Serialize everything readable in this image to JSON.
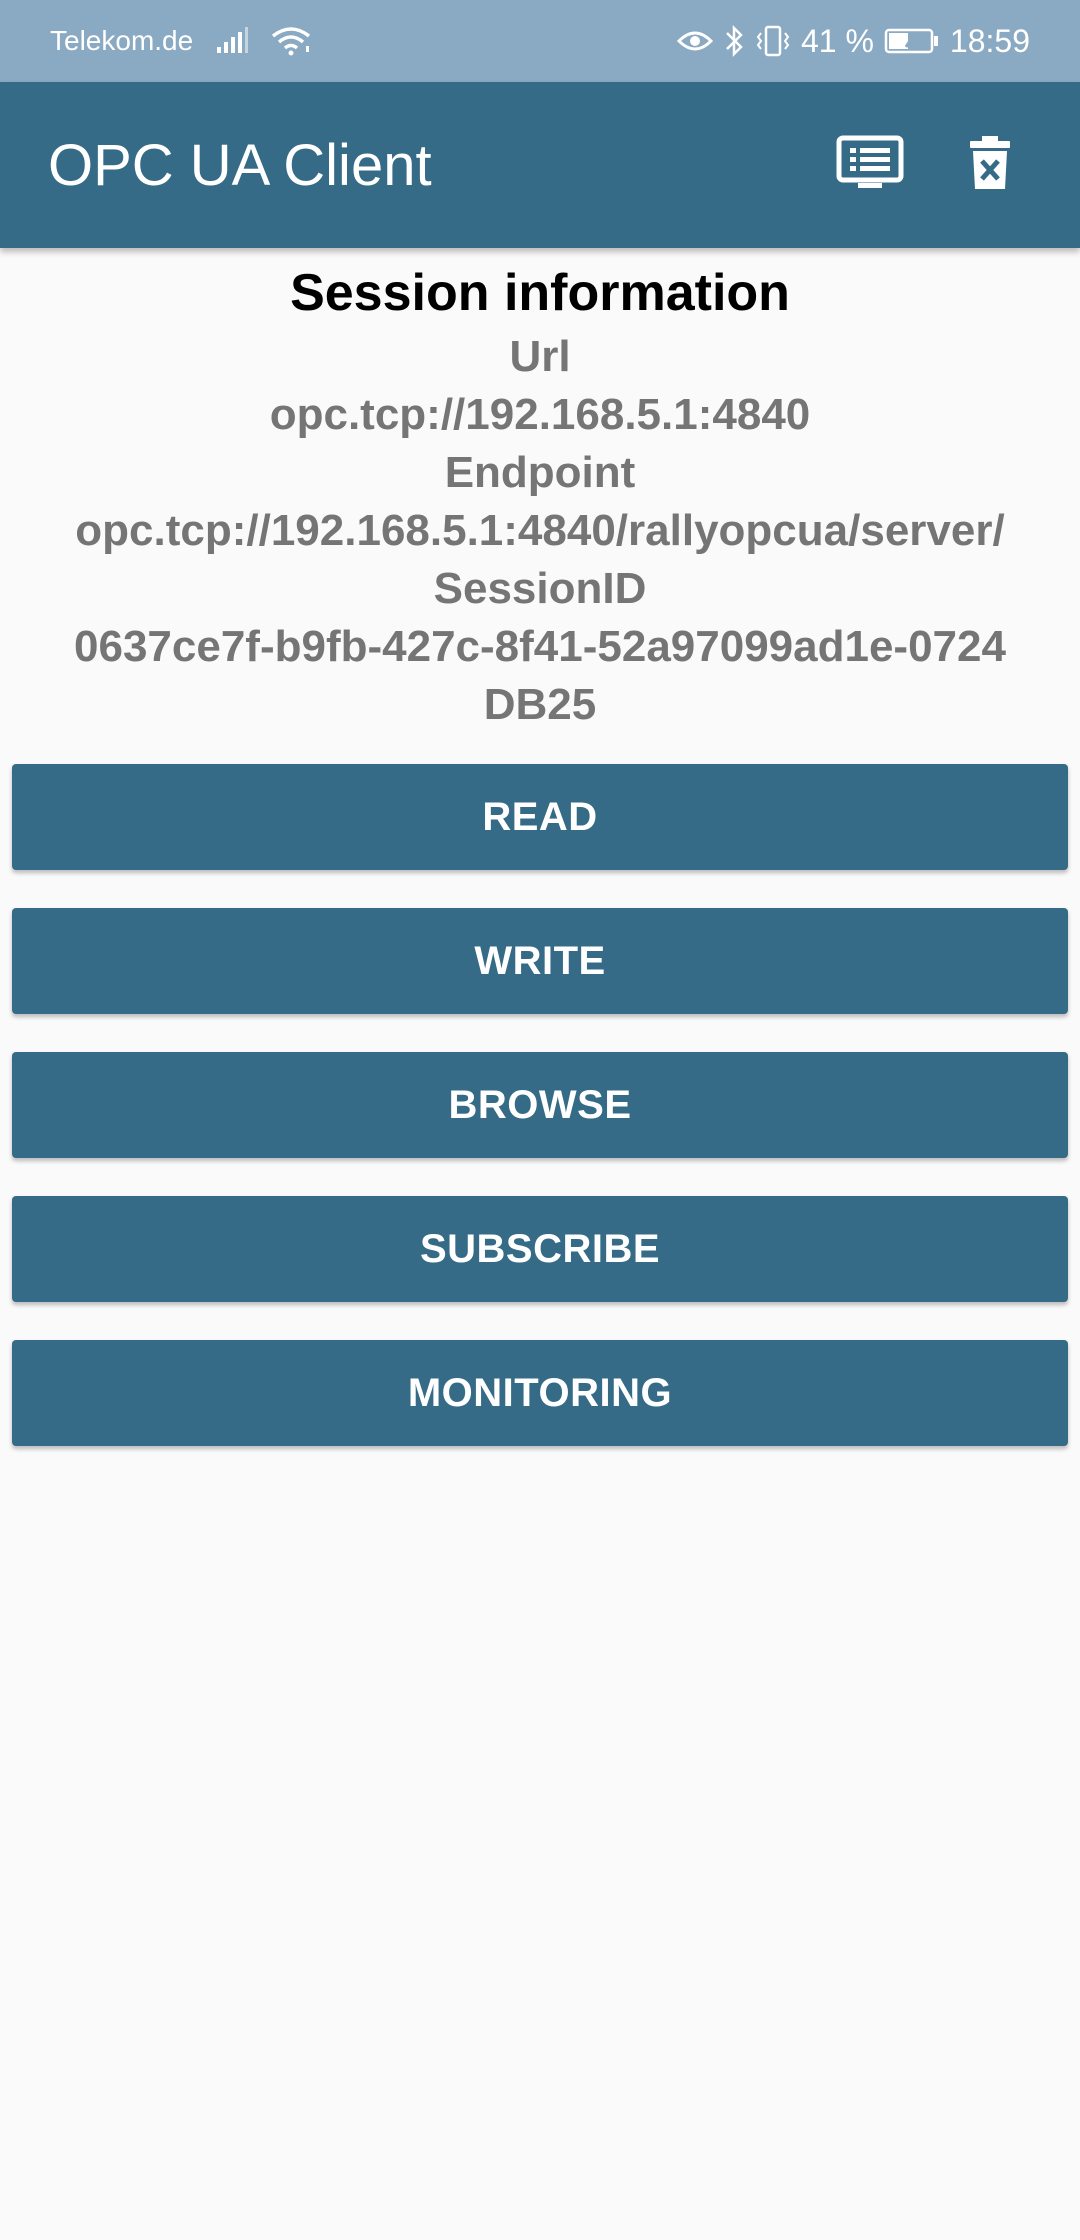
{
  "status_bar": {
    "carrier": "Telekom.de",
    "battery": "41 %",
    "time": "18:59",
    "icons": [
      "signal-icon",
      "wifi-icon",
      "eye-icon",
      "bluetooth-icon",
      "vibrate-icon",
      "battery-icon"
    ]
  },
  "app_bar": {
    "title": "OPC UA Client",
    "actions": [
      "log-icon",
      "delete-icon"
    ],
    "color": "#356b87"
  },
  "session": {
    "title": "Session information",
    "url_label": "Url",
    "url_value": "opc.tcp://192.168.5.1:4840",
    "endpoint_label": "Endpoint",
    "endpoint_value": "opc.tcp://192.168.5.1:4840/rallyopcua/server/",
    "session_id_label": "SessionID",
    "session_id_value": "0637ce7f-b9fb-427c-8f41-52a97099ad1e-0724\nDB25"
  },
  "buttons": {
    "read": "READ",
    "write": "WRITE",
    "browse": "BROWSE",
    "subscribe": "SUBSCRIBE",
    "monitoring": "MONITORING"
  }
}
